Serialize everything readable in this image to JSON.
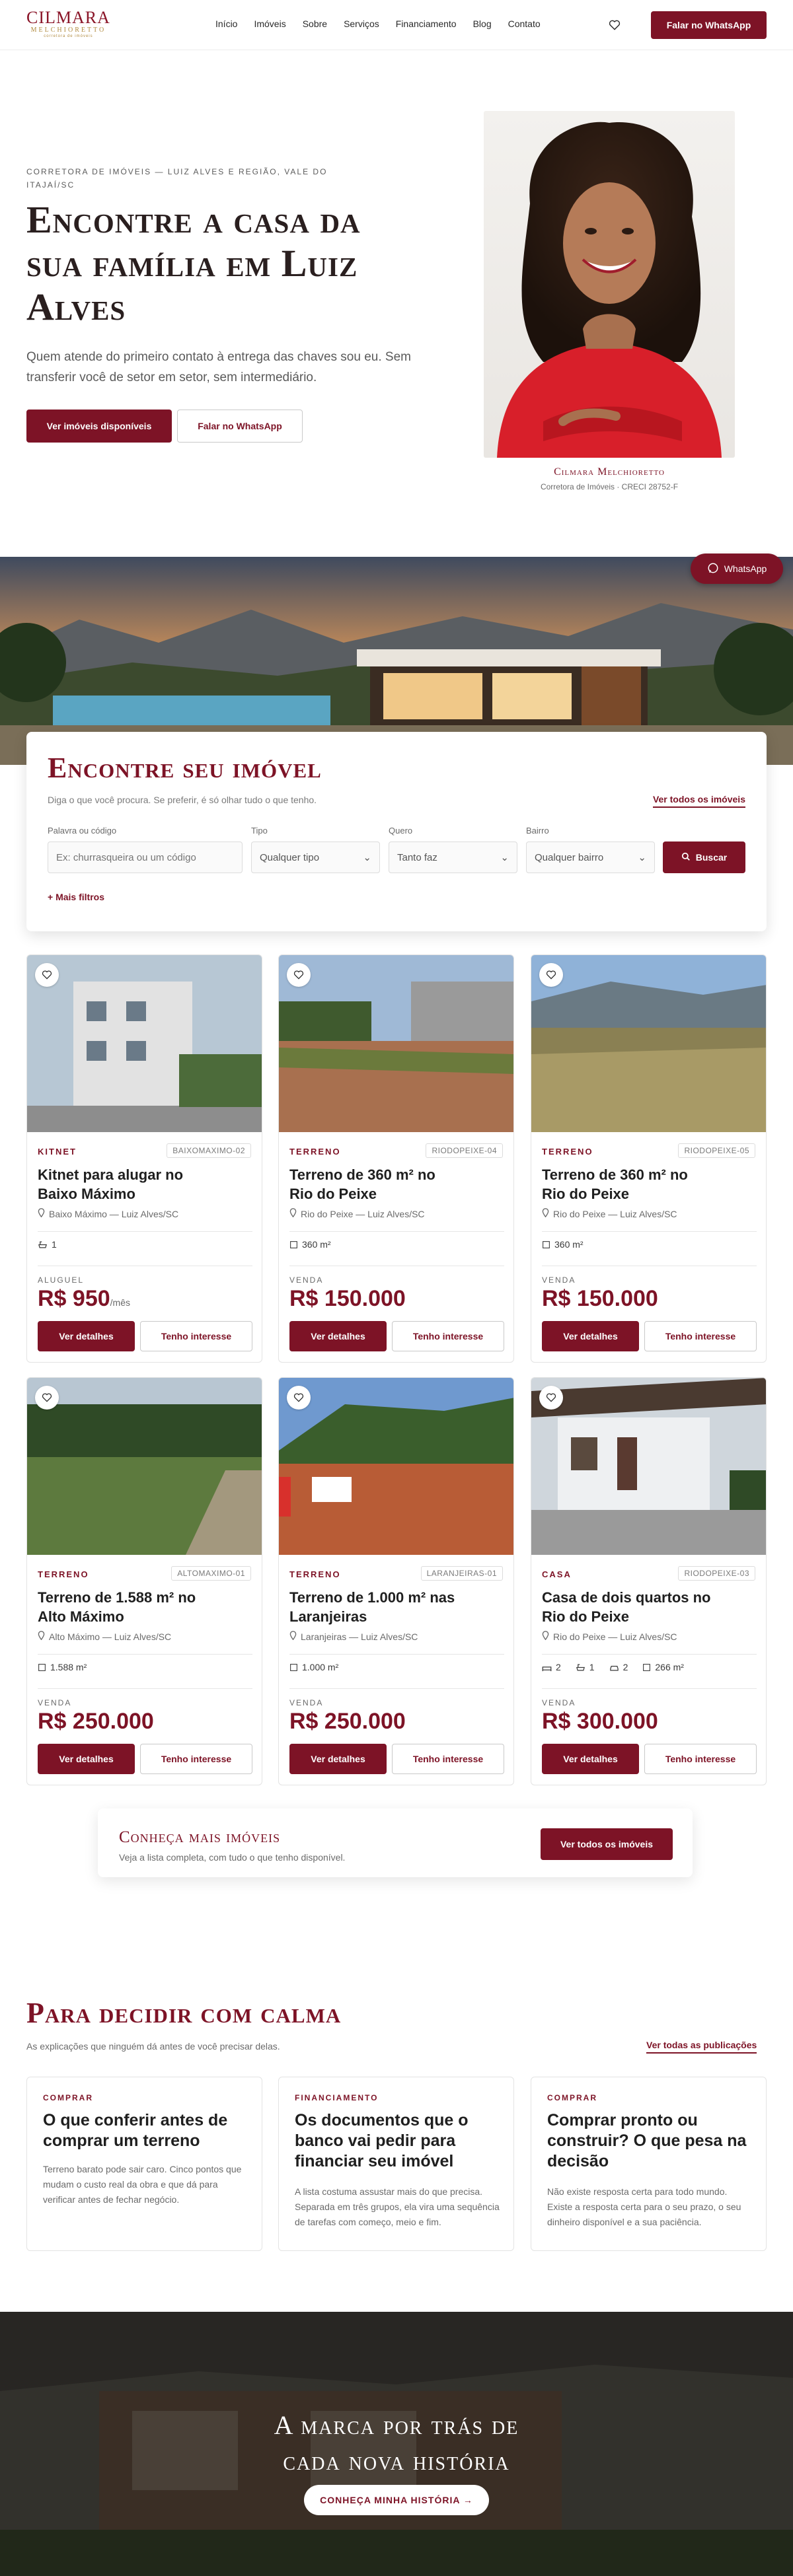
{
  "header": {
    "logo_main": "CILMARA",
    "logo_sub": "MELCHIORETTO",
    "logo_tag": "corretora de imóveis",
    "nav": [
      "Início",
      "Imóveis",
      "Sobre",
      "Serviços",
      "Financiamento",
      "Blog",
      "Contato"
    ],
    "cta": "Falar no WhatsApp"
  },
  "hero": {
    "eyebrow": "Corretora de imóveis — Luiz Alves e região, Vale do Itajaí/SC",
    "title": "Encontre a casa da sua família em Luiz Alves",
    "text": "Quem atende do primeiro contato à entrega das chaves sou eu. Sem transferir você de setor em setor, sem intermediário.",
    "btn_primary": "Ver imóveis disponíveis",
    "btn_secondary": "Falar no WhatsApp",
    "agent_name": "Cilmara Melchioretto",
    "agent_role": "Corretora de Imóveis · CRECI 28752-F"
  },
  "floating_whatsapp": "WhatsApp",
  "search": {
    "title": "Encontre seu imóvel",
    "subtitle": "Diga o que você procura. Se preferir, é só olhar tudo o que tenho.",
    "see_all": "Ver todos os imóveis",
    "keyword_label": "Palavra ou código",
    "keyword_placeholder": "Ex: churrasqueira ou um código",
    "type_label": "Tipo",
    "type_value": "Qualquer tipo",
    "want_label": "Quero",
    "want_value": "Tanto faz",
    "district_label": "Bairro",
    "district_value": "Qualquer bairro",
    "button": "Buscar",
    "more_filters": "Mais filtros"
  },
  "card_buttons": {
    "details": "Ver detalhes",
    "interest": "Tenho interesse"
  },
  "properties": [
    {
      "type": "KITNET",
      "code": "BAIXOMAXIMO-02",
      "title": "Kitnet para alugar no Baixo Máximo",
      "location": "Baixo Máximo — Luiz Alves/SC",
      "features": [
        "1"
      ],
      "deal": "ALUGUEL",
      "price": "R$ 950",
      "suffix": "/mês"
    },
    {
      "type": "TERRENO",
      "code": "RIODOPEIXE-04",
      "title": "Terreno de 360 m² no Rio do Peixe",
      "location": "Rio do Peixe — Luiz Alves/SC",
      "features": [
        "360 m²"
      ],
      "deal": "VENDA",
      "price": "R$ 150.000",
      "suffix": ""
    },
    {
      "type": "TERRENO",
      "code": "RIODOPEIXE-05",
      "title": "Terreno de 360 m² no Rio do Peixe",
      "location": "Rio do Peixe — Luiz Alves/SC",
      "features": [
        "360 m²"
      ],
      "deal": "VENDA",
      "price": "R$ 150.000",
      "suffix": ""
    },
    {
      "type": "TERRENO",
      "code": "ALTOMAXIMO-01",
      "title": "Terreno de 1.588 m² no Alto Máximo",
      "location": "Alto Máximo — Luiz Alves/SC",
      "features": [
        "1.588 m²"
      ],
      "deal": "VENDA",
      "price": "R$ 250.000",
      "suffix": ""
    },
    {
      "type": "TERRENO",
      "code": "LARANJEIRAS-01",
      "title": "Terreno de 1.000 m² nas Laranjeiras",
      "location": "Laranjeiras — Luiz Alves/SC",
      "features": [
        "1.000 m²"
      ],
      "deal": "VENDA",
      "price": "R$ 250.000",
      "suffix": ""
    },
    {
      "type": "CASA",
      "code": "RIODOPEIXE-03",
      "title": "Casa de dois quartos no Rio do Peixe",
      "location": "Rio do Peixe — Luiz Alves/SC",
      "features": [
        "2",
        "1",
        "2",
        "266 m²"
      ],
      "deal": "VENDA",
      "price": "R$ 300.000",
      "suffix": ""
    }
  ],
  "more": {
    "title": "Conheça mais imóveis",
    "subtitle": "Veja a lista completa, com tudo o que tenho disponível.",
    "button": "Ver todos os imóveis"
  },
  "articles": {
    "title": "Para decidir com calma",
    "subtitle": "As explicações que ninguém dá antes de você precisar delas.",
    "see_all": "Ver todas as publicações",
    "items": [
      {
        "category": "COMPRAR",
        "title": "O que conferir antes de comprar um terreno",
        "text": "Terreno barato pode sair caro. Cinco pontos que mudam o custo real da obra e que dá para verificar antes de fechar negócio."
      },
      {
        "category": "FINANCIAMENTO",
        "title": "Os documentos que o banco vai pedir para financiar seu imóvel",
        "text": "A lista costuma assustar mais do que precisa. Separada em três grupos, ela vira uma sequência de tarefas com começo, meio e fim."
      },
      {
        "category": "COMPRAR",
        "title": "Comprar pronto ou construir? O que pesa na decisão",
        "text": "Não existe resposta certa para todo mundo. Existe a resposta certa para o seu prazo, o seu dinheiro disponível e a sua paciência."
      }
    ]
  },
  "brand": {
    "title_line1": "A marca por trás de",
    "title_line2": "cada nova história",
    "button": "CONHEÇA MINHA HISTÓRIA →"
  },
  "colors": {
    "accent": "#7d1326",
    "gold": "#b08a3e"
  }
}
